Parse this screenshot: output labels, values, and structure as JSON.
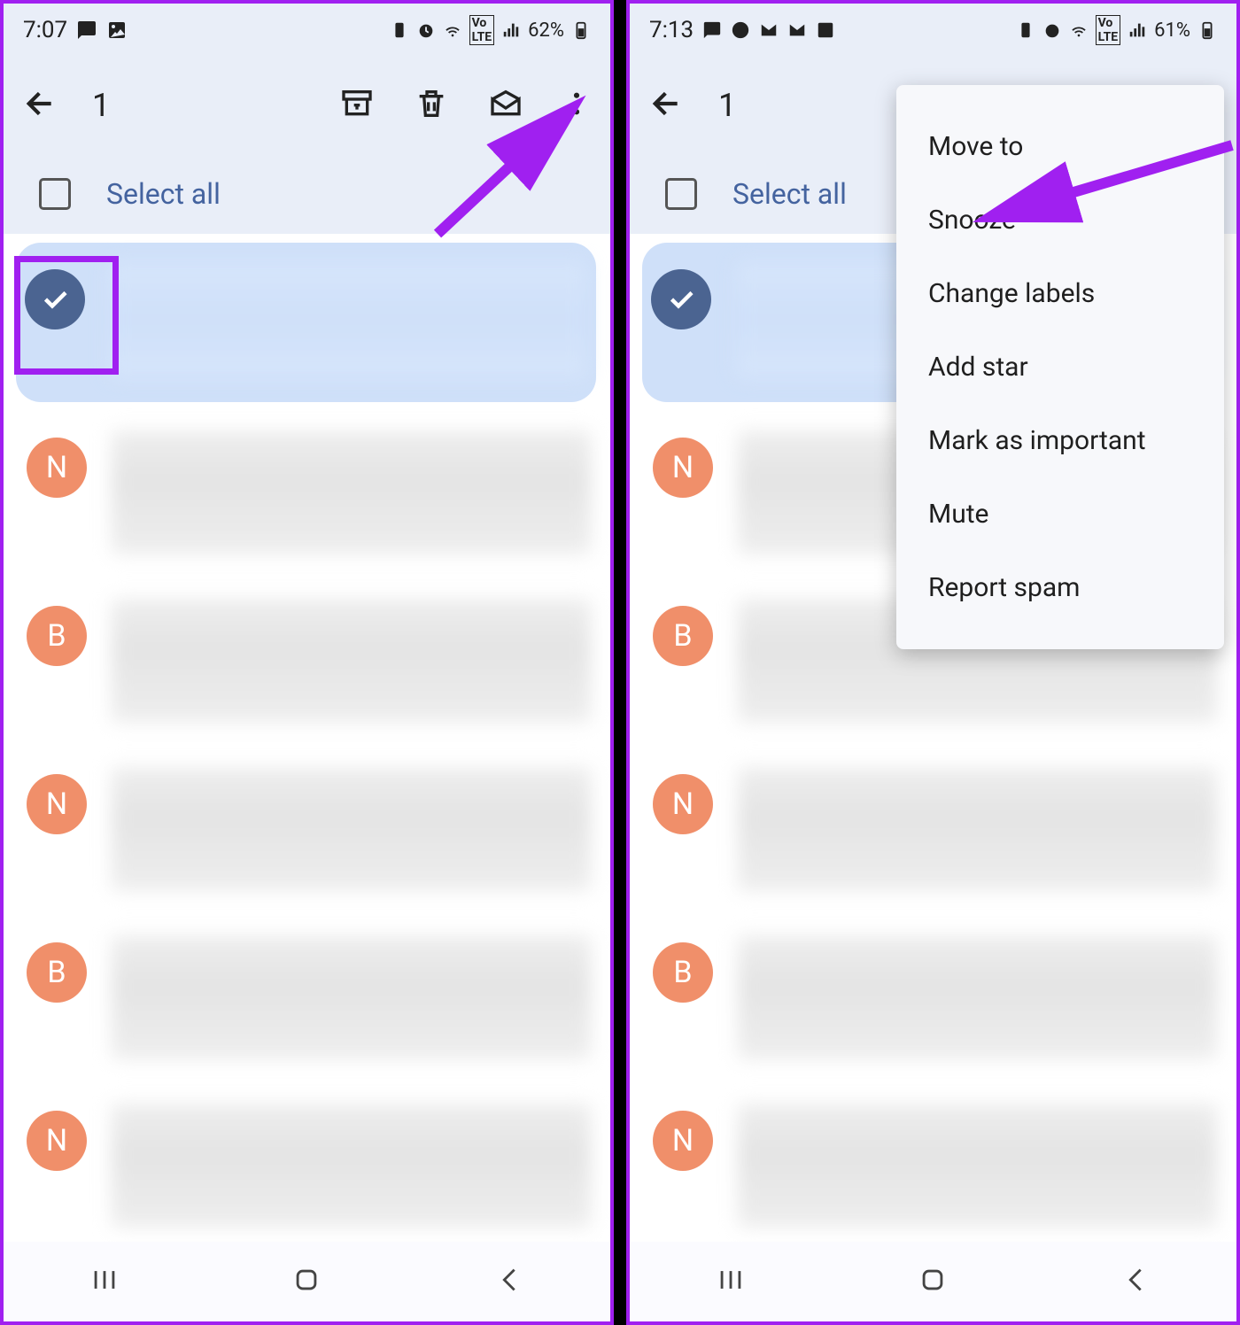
{
  "left": {
    "status": {
      "time": "7:07",
      "battery": "62%"
    },
    "appbar": {
      "count": "1"
    },
    "select_all": "Select all",
    "rows": [
      {
        "type": "check"
      },
      {
        "type": "letter",
        "letter": "N"
      },
      {
        "type": "letter",
        "letter": "B"
      },
      {
        "type": "letter",
        "letter": "N"
      },
      {
        "type": "letter",
        "letter": "B"
      },
      {
        "type": "letter",
        "letter": "N"
      }
    ]
  },
  "right": {
    "status": {
      "time": "7:13",
      "battery": "61%"
    },
    "appbar": {
      "count": "1"
    },
    "select_all": "Select all",
    "menu": {
      "items": [
        "Move to",
        "Snooze",
        "Change labels",
        "Add star",
        "Mark as important",
        "Mute",
        "Report spam"
      ]
    },
    "rows": [
      {
        "type": "check"
      },
      {
        "type": "letter",
        "letter": "N"
      },
      {
        "type": "letter",
        "letter": "B"
      },
      {
        "type": "letter",
        "letter": "N"
      },
      {
        "type": "letter",
        "letter": "B"
      },
      {
        "type": "letter",
        "letter": "N"
      }
    ]
  }
}
